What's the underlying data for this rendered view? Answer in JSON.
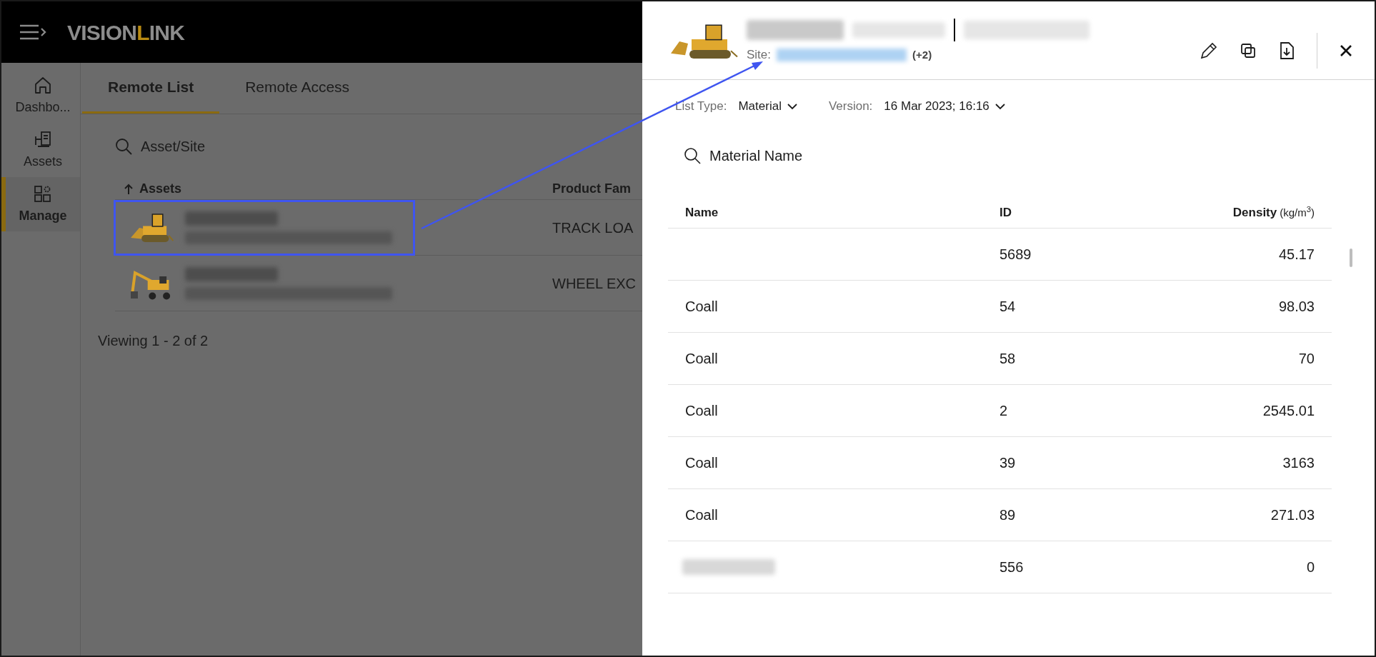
{
  "app_header": {
    "logo": [
      {
        "text": "VISION",
        "accent": false
      },
      {
        "text": "L",
        "accent": true
      },
      {
        "text": "INK",
        "accent": false
      }
    ]
  },
  "sidebar": {
    "items": [
      {
        "label": "Dashbo...",
        "kind": "home",
        "selected": false
      },
      {
        "label": "Assets",
        "kind": "machine",
        "selected": false
      },
      {
        "label": "Manage",
        "kind": "manage",
        "selected": true
      }
    ]
  },
  "tabs": [
    {
      "label": "Remote List",
      "selected": true
    },
    {
      "label": "Remote Access",
      "selected": false
    }
  ],
  "search": {
    "placeholder": "Asset/Site"
  },
  "table": {
    "columns": [
      {
        "label": "Assets",
        "sort_ascending": true
      },
      {
        "label": "Product Fam"
      }
    ],
    "rows": [
      {
        "kind": "track_loader",
        "redacted": true,
        "highlighted": true,
        "product_family": "TRACK LOA"
      },
      {
        "kind": "excavator",
        "redacted": true,
        "highlighted": false,
        "product_family": "WHEEL EXC"
      }
    ]
  },
  "footer": "Viewing 1 - 2 of 2",
  "panel": {
    "header": {
      "redacted": true,
      "site_label": "Site:",
      "site_count": "(+2)"
    },
    "filters": [
      {
        "label": "List Type:",
        "value": "Material"
      },
      {
        "label": "Version:",
        "value": "16 Mar 2023; 16:16"
      }
    ],
    "search": {
      "placeholder": "Material Name"
    },
    "columns": [
      {
        "label": "Name"
      },
      {
        "label": "ID"
      },
      {
        "label": "Density",
        "unit": "(kg/m$^{3}$)"
      }
    ],
    "rows": [
      {
        "id": "5689",
        "density": "45.17"
      },
      {
        "name": "Coall",
        "id": "54",
        "density": "98.03"
      },
      {
        "name": "Coall",
        "id": "58",
        "density": "70"
      },
      {
        "name": "Coall",
        "id": "2",
        "density": "2545.01"
      },
      {
        "name": "Coall",
        "id": "39",
        "density": "3163"
      },
      {
        "name": "Coall",
        "id": "89",
        "density": "271.03"
      },
      {
        "redacted": true,
        "id": "556",
        "density": "0"
      }
    ]
  }
}
